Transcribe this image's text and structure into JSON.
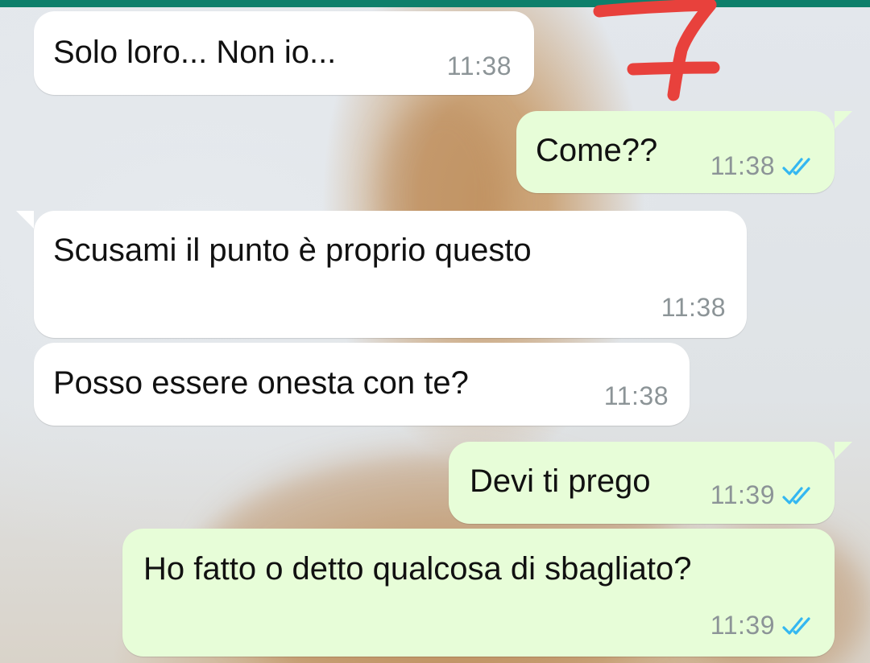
{
  "chat": {
    "accent_color": "#0e7f6b",
    "annotation_mark": "7",
    "annotation_color": "#e8413c",
    "read_tick_color": "#34b7f1",
    "messages": [
      {
        "id": "m1",
        "direction": "incoming",
        "text": "Solo loro... Non io...",
        "time": "11:38"
      },
      {
        "id": "m2",
        "direction": "outgoing",
        "text": "Come??",
        "time": "11:38",
        "status_icon": "double-check-read-icon"
      },
      {
        "id": "m3",
        "direction": "incoming",
        "text": "Scusami il punto è proprio questo",
        "time": "11:38"
      },
      {
        "id": "m4",
        "direction": "incoming",
        "text": "Posso essere onesta con te?",
        "time": "11:38"
      },
      {
        "id": "m5",
        "direction": "outgoing",
        "text": "Devi ti prego",
        "time": "11:39",
        "status_icon": "double-check-read-icon"
      },
      {
        "id": "m6",
        "direction": "outgoing",
        "text": "Ho fatto o detto qualcosa di sbagliato?",
        "time": "11:39",
        "status_icon": "double-check-read-icon"
      }
    ]
  }
}
